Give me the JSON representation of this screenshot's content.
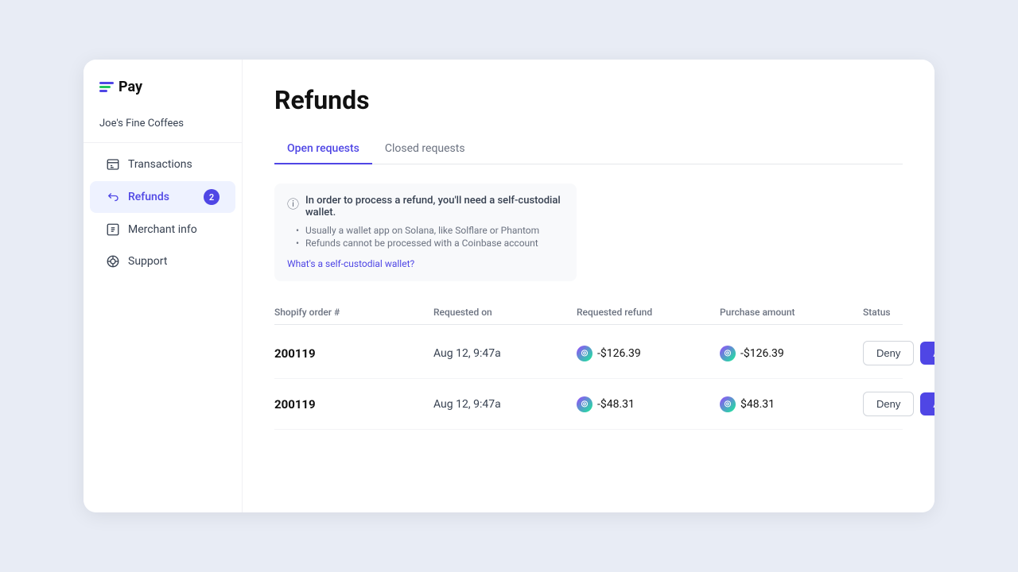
{
  "app": {
    "logo_text": "Pay",
    "colors": {
      "primary": "#4f46e5",
      "green": "#22c55e"
    }
  },
  "sidebar": {
    "merchant_name": "Joe's Fine Coffees",
    "nav_items": [
      {
        "id": "transactions",
        "label": "Transactions",
        "active": false,
        "badge": null
      },
      {
        "id": "refunds",
        "label": "Refunds",
        "active": true,
        "badge": "2"
      },
      {
        "id": "merchant-info",
        "label": "Merchant info",
        "active": false,
        "badge": null
      },
      {
        "id": "support",
        "label": "Support",
        "active": false,
        "badge": null
      }
    ]
  },
  "main": {
    "page_title": "Refunds",
    "tabs": [
      {
        "id": "open",
        "label": "Open requests",
        "active": true
      },
      {
        "id": "closed",
        "label": "Closed requests",
        "active": false
      }
    ],
    "info_box": {
      "title": "In order to process a refund, you'll need a self-custodial wallet.",
      "bullets": [
        "Usually a wallet app on Solana, like Solflare or Phantom",
        "Refunds cannot be processed with a Coinbase account"
      ],
      "link_text": "What's a self-custodial wallet?"
    },
    "table": {
      "headers": [
        "Shopify order #",
        "Requested on",
        "Requested refund",
        "Purchase amount",
        "Status"
      ],
      "rows": [
        {
          "order": "200119",
          "requested_on": "Aug 12, 9:47a",
          "requested_refund": "-$126.39",
          "purchase_amount": "-$126.39",
          "deny_label": "Deny",
          "approve_label": "Approve"
        },
        {
          "order": "200119",
          "requested_on": "Aug 12, 9:47a",
          "requested_refund": "-$48.31",
          "purchase_amount": "$48.31",
          "deny_label": "Deny",
          "approve_label": "Approve"
        }
      ]
    }
  }
}
